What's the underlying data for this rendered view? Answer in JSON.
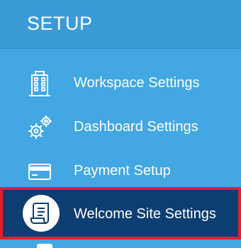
{
  "header": {
    "title": "SETUP"
  },
  "menu": {
    "items": [
      {
        "label": "Workspace Settings",
        "icon": "building-icon"
      },
      {
        "label": "Dashboard Settings",
        "icon": "gears-icon"
      },
      {
        "label": "Payment Setup",
        "icon": "credit-card-icon"
      },
      {
        "label": "Welcome Site Settings",
        "icon": "scroll-icon",
        "active": true
      }
    ]
  },
  "colors": {
    "panel_bg": "#42a7e2",
    "active_bg": "#0d3e72",
    "highlight_border": "#e3202a",
    "text": "#ffffff"
  }
}
